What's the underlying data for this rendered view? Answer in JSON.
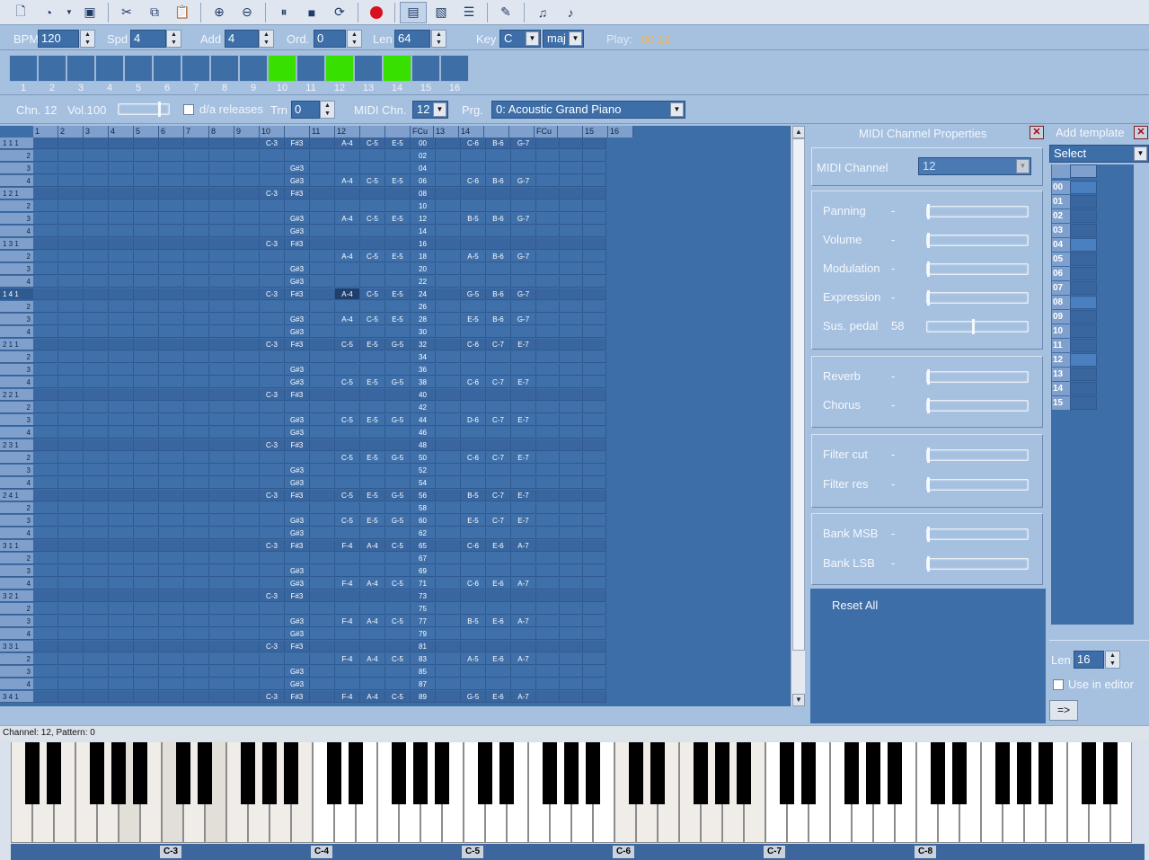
{
  "toolbar": {
    "buttons": [
      "new-file-icon",
      "open-icon",
      "dropdown-arrow-icon",
      "save-icon",
      "cut-icon",
      "copy-icon",
      "paste-icon",
      "zoom-in-icon",
      "zoom-out-icon",
      "pause-icon",
      "stop-icon",
      "loop-icon",
      "record-icon",
      "pattern-view-icon",
      "image-view-icon",
      "list-view-icon",
      "edit-icon",
      "note-tool-icon",
      "note-plus-icon"
    ]
  },
  "transport": {
    "bpm_label": "BPM",
    "bpm": "120",
    "spd_label": "Spd",
    "spd": "4",
    "add_label": "Add",
    "add": "4",
    "ord_label": "Ord.",
    "ord": "0",
    "len_label": "Len",
    "len": "64",
    "key_label": "Key",
    "key": "C",
    "mode": "maj",
    "play_label": "Play:",
    "play_value": "00 12"
  },
  "steps": {
    "numbers": [
      "1",
      "2",
      "3",
      "4",
      "5",
      "6",
      "7",
      "8",
      "9",
      "10",
      "11",
      "12",
      "13",
      "14",
      "15",
      "16"
    ],
    "active": [
      10,
      12,
      14
    ]
  },
  "channel_bar": {
    "chn": "Chn. 12",
    "vol": "Vol.100",
    "da_releases": "d/a releases",
    "trn_label": "Trn",
    "trn": "0",
    "midi_chn_label": "MIDI Chn.",
    "midi_chn": "12",
    "prg_label": "Prg.",
    "prg": "0: Acoustic Grand Piano"
  },
  "grid": {
    "headers": [
      "1",
      "2",
      "3",
      "4",
      "5",
      "6",
      "7",
      "8",
      "9",
      "10",
      "",
      "11",
      "12",
      "",
      "",
      "FCu",
      "13",
      "14",
      "",
      "",
      "FCu",
      "",
      "15",
      "16"
    ],
    "rows": [
      [
        "1 1 1",
        "",
        "",
        "",
        "",
        "",
        "",
        "",
        "",
        "",
        "C-3",
        "F#3",
        "",
        "A-4",
        "C-5",
        "E-5",
        "00",
        "",
        "C-6",
        "B-6",
        "G-7"
      ],
      [
        "2",
        "",
        "",
        "",
        "",
        "",
        "",
        "",
        "",
        "",
        "",
        "",
        "",
        "",
        "",
        "",
        "02",
        "",
        "",
        "",
        ""
      ],
      [
        "3",
        "",
        "",
        "",
        "",
        "",
        "",
        "",
        "",
        "",
        "",
        "G#3",
        "",
        "",
        "",
        "",
        "04",
        "",
        "",
        "",
        ""
      ],
      [
        "4",
        "",
        "",
        "",
        "",
        "",
        "",
        "",
        "",
        "",
        "",
        "G#3",
        "",
        "A-4",
        "C-5",
        "E-5",
        "06",
        "",
        "C-6",
        "B-6",
        "G-7"
      ],
      [
        "1 2 1",
        "",
        "",
        "",
        "",
        "",
        "",
        "",
        "",
        "",
        "C-3",
        "F#3",
        "",
        "",
        "",
        "",
        "08",
        "",
        "",
        "",
        ""
      ],
      [
        "2",
        "",
        "",
        "",
        "",
        "",
        "",
        "",
        "",
        "",
        "",
        "",
        "",
        "",
        "",
        "",
        "10",
        "",
        "",
        "",
        ""
      ],
      [
        "3",
        "",
        "",
        "",
        "",
        "",
        "",
        "",
        "",
        "",
        "",
        "G#3",
        "",
        "A-4",
        "C-5",
        "E-5",
        "12",
        "",
        "B-5",
        "B-6",
        "G-7"
      ],
      [
        "4",
        "",
        "",
        "",
        "",
        "",
        "",
        "",
        "",
        "",
        "",
        "G#3",
        "",
        "",
        "",
        "",
        "14",
        "",
        "",
        "",
        ""
      ],
      [
        "1 3 1",
        "",
        "",
        "",
        "",
        "",
        "",
        "",
        "",
        "",
        "C-3",
        "F#3",
        "",
        "",
        "",
        "",
        "16",
        "",
        "",
        "",
        ""
      ],
      [
        "2",
        "",
        "",
        "",
        "",
        "",
        "",
        "",
        "",
        "",
        "",
        "",
        "",
        "A-4",
        "C-5",
        "E-5",
        "18",
        "",
        "A-5",
        "B-6",
        "G-7"
      ],
      [
        "3",
        "",
        "",
        "",
        "",
        "",
        "",
        "",
        "",
        "",
        "",
        "G#3",
        "",
        "",
        "",
        "",
        "20",
        "",
        "",
        "",
        ""
      ],
      [
        "4",
        "",
        "",
        "",
        "",
        "",
        "",
        "",
        "",
        "",
        "",
        "G#3",
        "",
        "",
        "",
        "",
        "22",
        "",
        "",
        "",
        ""
      ],
      [
        "1 4 1",
        "",
        "",
        "",
        "",
        "",
        "",
        "",
        "",
        "",
        "C-3",
        "F#3",
        "",
        "A-4",
        "C-5",
        "E-5",
        "24",
        "",
        "G-5",
        "B-6",
        "G-7"
      ],
      [
        "2",
        "",
        "",
        "",
        "",
        "",
        "",
        "",
        "",
        "",
        "",
        "",
        "",
        "",
        "",
        "",
        "26",
        "",
        "",
        "",
        ""
      ],
      [
        "3",
        "",
        "",
        "",
        "",
        "",
        "",
        "",
        "",
        "",
        "",
        "G#3",
        "",
        "A-4",
        "C-5",
        "E-5",
        "28",
        "",
        "E-5",
        "B-6",
        "G-7"
      ],
      [
        "4",
        "",
        "",
        "",
        "",
        "",
        "",
        "",
        "",
        "",
        "",
        "G#3",
        "",
        "",
        "",
        "",
        "30",
        "",
        "",
        "",
        ""
      ],
      [
        "2 1 1",
        "",
        "",
        "",
        "",
        "",
        "",
        "",
        "",
        "",
        "C-3",
        "F#3",
        "",
        "C-5",
        "E-5",
        "G-5",
        "32",
        "",
        "C-6",
        "C-7",
        "E-7"
      ],
      [
        "2",
        "",
        "",
        "",
        "",
        "",
        "",
        "",
        "",
        "",
        "",
        "",
        "",
        "",
        "",
        "",
        "34",
        "",
        "",
        "",
        ""
      ],
      [
        "3",
        "",
        "",
        "",
        "",
        "",
        "",
        "",
        "",
        "",
        "",
        "G#3",
        "",
        "",
        "",
        "",
        "36",
        "",
        "",
        "",
        ""
      ],
      [
        "4",
        "",
        "",
        "",
        "",
        "",
        "",
        "",
        "",
        "",
        "",
        "G#3",
        "",
        "C-5",
        "E-5",
        "G-5",
        "38",
        "",
        "C-6",
        "C-7",
        "E-7"
      ],
      [
        "2 2 1",
        "",
        "",
        "",
        "",
        "",
        "",
        "",
        "",
        "",
        "C-3",
        "F#3",
        "",
        "",
        "",
        "",
        "40",
        "",
        "",
        "",
        ""
      ],
      [
        "2",
        "",
        "",
        "",
        "",
        "",
        "",
        "",
        "",
        "",
        "",
        "",
        "",
        "",
        "",
        "",
        "42",
        "",
        "",
        "",
        ""
      ],
      [
        "3",
        "",
        "",
        "",
        "",
        "",
        "",
        "",
        "",
        "",
        "",
        "G#3",
        "",
        "C-5",
        "E-5",
        "G-5",
        "44",
        "",
        "D-6",
        "C-7",
        "E-7"
      ],
      [
        "4",
        "",
        "",
        "",
        "",
        "",
        "",
        "",
        "",
        "",
        "",
        "G#3",
        "",
        "",
        "",
        "",
        "46",
        "",
        "",
        "",
        ""
      ],
      [
        "2 3 1",
        "",
        "",
        "",
        "",
        "",
        "",
        "",
        "",
        "",
        "C-3",
        "F#3",
        "",
        "",
        "",
        "",
        "48",
        "",
        "",
        "",
        ""
      ],
      [
        "2",
        "",
        "",
        "",
        "",
        "",
        "",
        "",
        "",
        "",
        "",
        "",
        "",
        "C-5",
        "E-5",
        "G-5",
        "50",
        "",
        "C-6",
        "C-7",
        "E-7"
      ],
      [
        "3",
        "",
        "",
        "",
        "",
        "",
        "",
        "",
        "",
        "",
        "",
        "G#3",
        "",
        "",
        "",
        "",
        "52",
        "",
        "",
        "",
        ""
      ],
      [
        "4",
        "",
        "",
        "",
        "",
        "",
        "",
        "",
        "",
        "",
        "",
        "G#3",
        "",
        "",
        "",
        "",
        "54",
        "",
        "",
        "",
        ""
      ],
      [
        "2 4 1",
        "",
        "",
        "",
        "",
        "",
        "",
        "",
        "",
        "",
        "C-3",
        "F#3",
        "",
        "C-5",
        "E-5",
        "G-5",
        "56",
        "",
        "B-5",
        "C-7",
        "E-7"
      ],
      [
        "2",
        "",
        "",
        "",
        "",
        "",
        "",
        "",
        "",
        "",
        "",
        "",
        "",
        "",
        "",
        "",
        "58",
        "",
        "",
        "",
        ""
      ],
      [
        "3",
        "",
        "",
        "",
        "",
        "",
        "",
        "",
        "",
        "",
        "",
        "G#3",
        "",
        "C-5",
        "E-5",
        "G-5",
        "60",
        "",
        "E-5",
        "C-7",
        "E-7"
      ],
      [
        "4",
        "",
        "",
        "",
        "",
        "",
        "",
        "",
        "",
        "",
        "",
        "G#3",
        "",
        "",
        "",
        "",
        "62",
        "",
        "",
        "",
        ""
      ],
      [
        "3 1 1",
        "",
        "",
        "",
        "",
        "",
        "",
        "",
        "",
        "",
        "C-3",
        "F#3",
        "",
        "F-4",
        "A-4",
        "C-5",
        "65",
        "",
        "C-6",
        "E-6",
        "A-7"
      ],
      [
        "2",
        "",
        "",
        "",
        "",
        "",
        "",
        "",
        "",
        "",
        "",
        "",
        "",
        "",
        "",
        "",
        "67",
        "",
        "",
        "",
        ""
      ],
      [
        "3",
        "",
        "",
        "",
        "",
        "",
        "",
        "",
        "",
        "",
        "",
        "G#3",
        "",
        "",
        "",
        "",
        "69",
        "",
        "",
        "",
        ""
      ],
      [
        "4",
        "",
        "",
        "",
        "",
        "",
        "",
        "",
        "",
        "",
        "",
        "G#3",
        "",
        "F-4",
        "A-4",
        "C-5",
        "71",
        "",
        "C-6",
        "E-6",
        "A-7"
      ],
      [
        "3 2 1",
        "",
        "",
        "",
        "",
        "",
        "",
        "",
        "",
        "",
        "C-3",
        "F#3",
        "",
        "",
        "",
        "",
        "73",
        "",
        "",
        "",
        ""
      ],
      [
        "2",
        "",
        "",
        "",
        "",
        "",
        "",
        "",
        "",
        "",
        "",
        "",
        "",
        "",
        "",
        "",
        "75",
        "",
        "",
        "",
        ""
      ],
      [
        "3",
        "",
        "",
        "",
        "",
        "",
        "",
        "",
        "",
        "",
        "",
        "G#3",
        "",
        "F-4",
        "A-4",
        "C-5",
        "77",
        "",
        "B-5",
        "E-6",
        "A-7"
      ],
      [
        "4",
        "",
        "",
        "",
        "",
        "",
        "",
        "",
        "",
        "",
        "",
        "G#3",
        "",
        "",
        "",
        "",
        "79",
        "",
        "",
        "",
        ""
      ],
      [
        "3 3 1",
        "",
        "",
        "",
        "",
        "",
        "",
        "",
        "",
        "",
        "C-3",
        "F#3",
        "",
        "",
        "",
        "",
        "81",
        "",
        "",
        "",
        ""
      ],
      [
        "2",
        "",
        "",
        "",
        "",
        "",
        "",
        "",
        "",
        "",
        "",
        "",
        "",
        "F-4",
        "A-4",
        "C-5",
        "83",
        "",
        "A-5",
        "E-6",
        "A-7"
      ],
      [
        "3",
        "",
        "",
        "",
        "",
        "",
        "",
        "",
        "",
        "",
        "",
        "G#3",
        "",
        "",
        "",
        "",
        "85",
        "",
        "",
        "",
        ""
      ],
      [
        "4",
        "",
        "",
        "",
        "",
        "",
        "",
        "",
        "",
        "",
        "",
        "G#3",
        "",
        "",
        "",
        "",
        "87",
        "",
        "",
        "",
        ""
      ],
      [
        "3 4 1",
        "",
        "",
        "",
        "",
        "",
        "",
        "",
        "",
        "",
        "C-3",
        "F#3",
        "",
        "F-4",
        "A-4",
        "C-5",
        "89",
        "",
        "G-5",
        "E-6",
        "A-7"
      ]
    ]
  },
  "midi_props": {
    "title": "MIDI Channel Properties",
    "channel_label": "MIDI Channel",
    "channel": "12",
    "controls": [
      {
        "label": "Panning",
        "value": "-",
        "level": 0
      },
      {
        "label": "Volume",
        "value": "-",
        "level": 0
      },
      {
        "label": "Modulation",
        "value": "-",
        "level": 0
      },
      {
        "label": "Expression",
        "value": "-",
        "level": 0
      },
      {
        "label": "Sus. pedal",
        "value": "58",
        "level": 0.46
      },
      {
        "label": "Reverb",
        "value": "-",
        "level": 0
      },
      {
        "label": "Chorus",
        "value": "-",
        "level": 0
      },
      {
        "label": "Filter cut",
        "value": "-",
        "level": 0
      },
      {
        "label": "Filter res",
        "value": "-",
        "level": 0
      },
      {
        "label": "Bank MSB",
        "value": "-",
        "level": 0
      },
      {
        "label": "Bank LSB",
        "value": "-",
        "level": 0
      }
    ],
    "reset": "Reset All"
  },
  "template": {
    "title": "Add template",
    "select": "Select",
    "rows": [
      "00",
      "01",
      "02",
      "03",
      "04",
      "05",
      "06",
      "07",
      "08",
      "09",
      "10",
      "11",
      "12",
      "13",
      "14",
      "15"
    ],
    "selected": [
      "00",
      "04",
      "08",
      "12"
    ],
    "len_label": "Len",
    "len": "16",
    "use_in_editor": "Use in editor",
    "apply": "=>"
  },
  "status": "Channel: 12, Pattern: 0",
  "piano": {
    "octaves": [
      "C-3",
      "C-4",
      "C-5",
      "C-6",
      "C-7",
      "C-8"
    ]
  }
}
